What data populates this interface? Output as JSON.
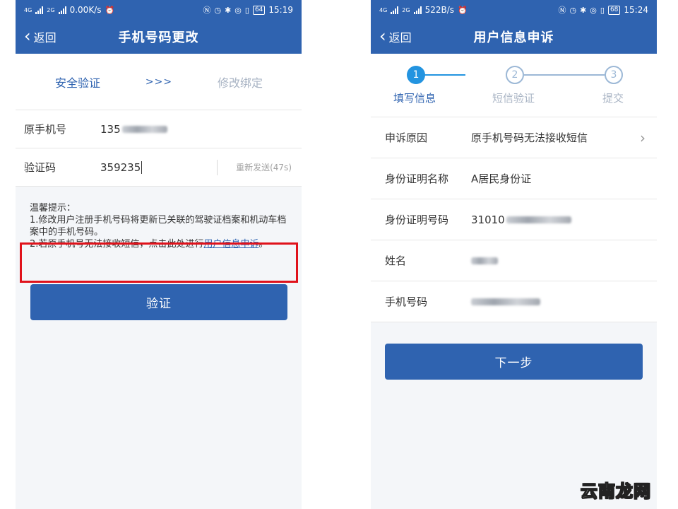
{
  "left": {
    "status": {
      "network_tags": [
        "4G",
        "2G"
      ],
      "speed": "0.00K/s",
      "battery": "64",
      "time": "15:19"
    },
    "nav": {
      "back_label": "返回",
      "title": "手机号码更改"
    },
    "steps": {
      "active": "安全验证",
      "arrow": ">>>",
      "inactive": "修改绑定"
    },
    "form": {
      "old_phone_label": "原手机号",
      "old_phone_value": "135",
      "code_label": "验证码",
      "code_value": "359235",
      "resend_label": "重新发送(47s)"
    },
    "tips": {
      "title": "温馨提示：",
      "line1": "1.修改用户注册手机号码将更新已关联的驾驶证档案和机动车档案中的手机号码。",
      "line2_prefix": "2.若原手机号无法接收短信，点击此处进行",
      "line2_link": "用户信息申诉",
      "line2_suffix": "。"
    },
    "verify_button": "验证",
    "colors": {
      "primary": "#2f63b0",
      "highlight": "#e0121b"
    }
  },
  "right": {
    "status": {
      "network_tags": [
        "4G",
        "2G"
      ],
      "speed": "522B/s",
      "battery": "68",
      "time": "15:24"
    },
    "nav": {
      "back_label": "返回",
      "title": "用户信息申诉"
    },
    "steps": [
      {
        "num": "1",
        "label": "填写信息",
        "state": "active"
      },
      {
        "num": "2",
        "label": "短信验证",
        "state": "pending"
      },
      {
        "num": "3",
        "label": "提交",
        "state": "pending"
      }
    ],
    "rows": [
      {
        "label": "申诉原因",
        "value": "原手机号码无法接收短信"
      },
      {
        "label": "身份证明名称",
        "value": "A居民身份证"
      },
      {
        "label": "身份证明号码",
        "value": "31010"
      },
      {
        "label": "姓名",
        "value": ""
      },
      {
        "label": "手机号码",
        "value": ""
      }
    ],
    "next_button": "下一步",
    "colors": {
      "step_active": "#2394e0"
    }
  },
  "watermark": {
    "part1": "云南",
    "part2": "龙",
    "part3": "网"
  },
  "icons": [
    "back-arrow-icon",
    "alarm-icon",
    "nfc-icon",
    "clock-icon",
    "bluetooth-icon",
    "location-icon",
    "vibrate-icon",
    "chevron-right-icon"
  ]
}
